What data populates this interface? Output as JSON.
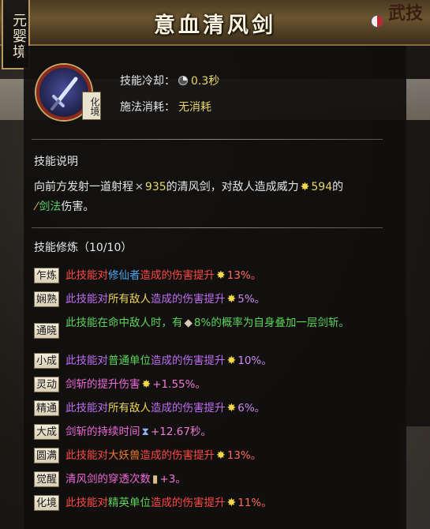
{
  "header": {
    "realm": "元婴境",
    "title": "意血清风剑",
    "corner_label": "武技"
  },
  "skill": {
    "icon": "sword-icon",
    "badge": "化境",
    "cooldown_label": "技能冷却：",
    "cooldown_value": "0.3秒",
    "cost_label": "施法消耗：",
    "cost_value": "无消耗"
  },
  "description": {
    "heading": "技能说明",
    "line1_a": "向前方发射一道射程",
    "range": "935",
    "line1_b": "的清风剑，对敌人造成威力",
    "power": "594",
    "line1_c": "的",
    "type": "剑法",
    "line2_b": "伤害。"
  },
  "cultivation": {
    "heading": "技能修炼（10/10）",
    "rows": [
      {
        "badge": "乍炼",
        "a": "此技能对",
        "b": "修仙者",
        "c": "造成的伤害提升",
        "val": "13%。"
      },
      {
        "badge": "娴熟",
        "a": "此技能对",
        "b": "所有敌人",
        "c": "造成的伤害提升",
        "val": "5%。"
      },
      {
        "badge": "通晓",
        "a": "此技能在命中敌人时，有",
        "val": "8%的概率为自身叠加一层剑斩。"
      },
      {
        "badge": "小成",
        "a": "此技能对",
        "b": "普通单位",
        "c": "造成的伤害提升",
        "val": "10%。"
      },
      {
        "badge": "灵动",
        "a": "剑斩",
        "c": "的提升伤害",
        "val": "+1.55%。"
      },
      {
        "badge": "精通",
        "a": "此技能对",
        "b": "所有敌人",
        "c": "造成的伤害提升",
        "val": "6%。"
      },
      {
        "badge": "大成",
        "a": "剑斩",
        "c": "的持续时间",
        "val": "+12.67秒。"
      },
      {
        "badge": "圆满",
        "a": "此技能对",
        "b": "大妖兽",
        "c": "造成的伤害提升",
        "val": "13%。"
      },
      {
        "badge": "觉醒",
        "a": "清风剑",
        "c": "的穿透次数",
        "val": "+3。"
      },
      {
        "badge": "化境",
        "a": "此技能对",
        "b": "精英单位",
        "c": "造成的伤害提升",
        "val": "11%。"
      }
    ]
  }
}
